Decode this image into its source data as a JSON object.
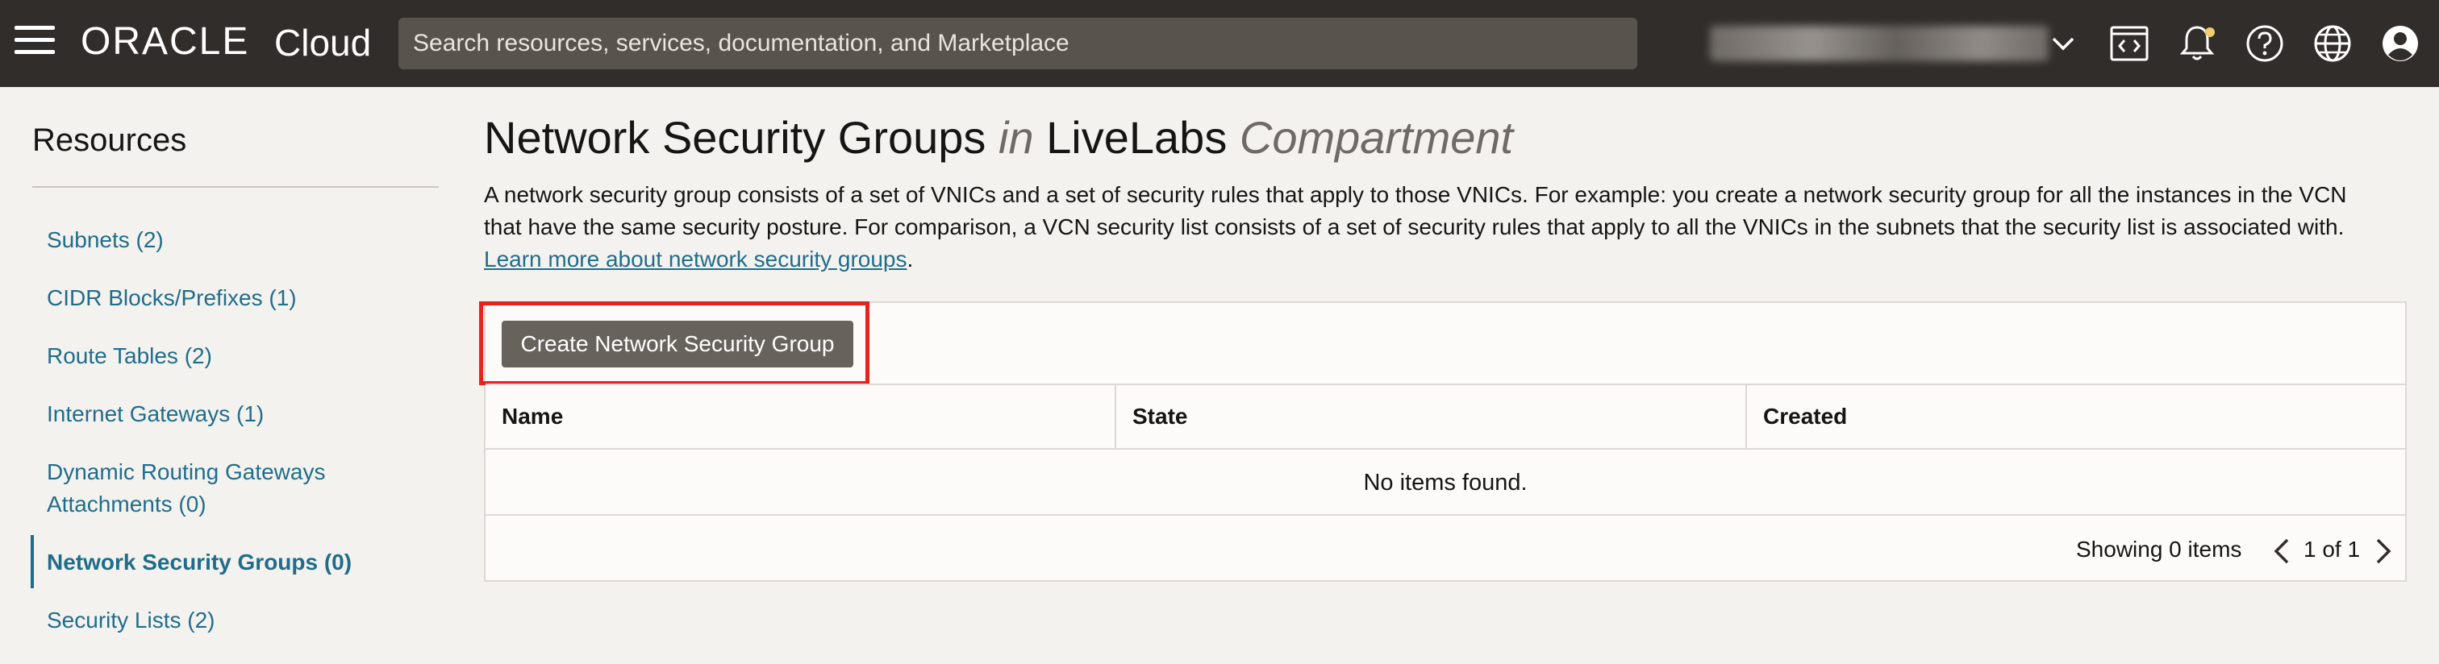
{
  "header": {
    "brand": "ORACLE",
    "product": "Cloud",
    "search_placeholder": "Search resources, services, documentation, and Marketplace"
  },
  "sidebar": {
    "title": "Resources",
    "items": [
      {
        "label": "Subnets (2)"
      },
      {
        "label": "CIDR Blocks/Prefixes (1)"
      },
      {
        "label": "Route Tables (2)"
      },
      {
        "label": "Internet Gateways (1)"
      },
      {
        "label_line1": "Dynamic Routing Gateways",
        "label_line2": "Attachments (0)"
      },
      {
        "label": "Network Security Groups (0)",
        "active": true
      },
      {
        "label": "Security Lists (2)"
      }
    ]
  },
  "main": {
    "title_main": "Network Security Groups",
    "title_in": "in",
    "title_compartment": "LiveLabs",
    "title_compartment_suffix": "Compartment",
    "description": "A network security group consists of a set of VNICs and a set of security rules that apply to those VNICs. For example: you create a network security group for all the instances in the VCN that have the same security posture. For comparison, a VCN security list consists of a set of security rules that apply to all the VNICs in the subnets that the security list is associated with.",
    "learn_more": "Learn more about network security groups",
    "description_end": ".",
    "create_button": "Create Network Security Group",
    "table": {
      "columns": [
        "Name",
        "State",
        "Created"
      ],
      "empty_message": "No items found.",
      "showing": "Showing 0 items",
      "page": "1 of 1"
    }
  },
  "colors": {
    "topbar": "#312d2a",
    "link": "#1f6d8b",
    "highlight": "#e8231b",
    "button": "#68625c"
  },
  "icons": [
    "hamburger-icon",
    "chevron-down-icon",
    "code-editor-icon",
    "bell-icon",
    "help-icon",
    "globe-icon",
    "profile-icon",
    "chevron-left-icon",
    "chevron-right-icon"
  ]
}
